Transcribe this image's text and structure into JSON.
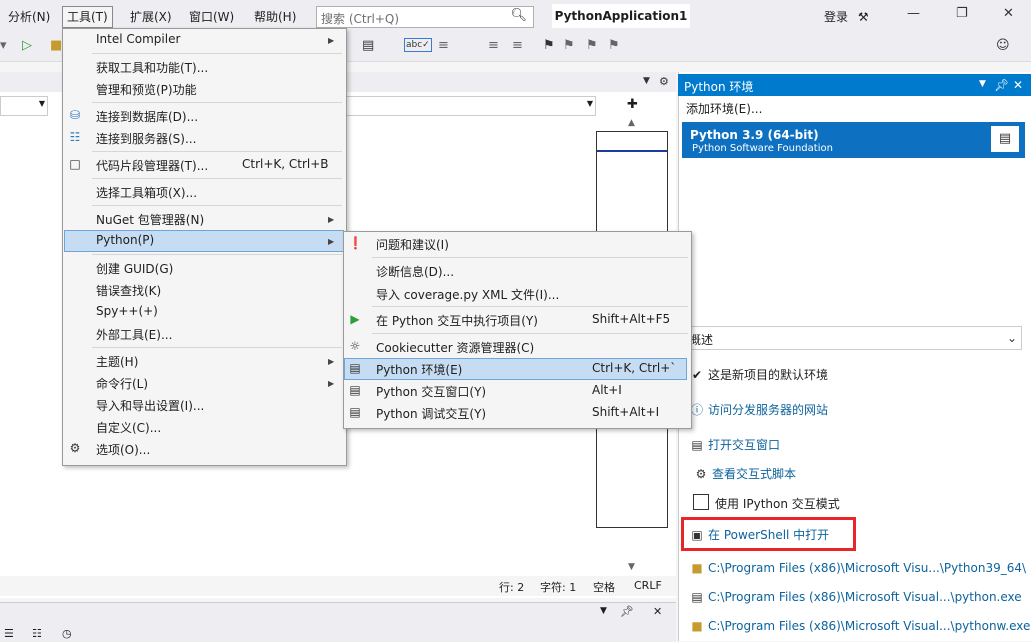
{
  "menubar": {
    "items": [
      "分析(N)",
      "工具(T)",
      "扩展(X)",
      "窗口(W)",
      "帮助(H)"
    ],
    "search_placeholder": "搜索 (Ctrl+Q)",
    "project_title": "PythonApplication1",
    "login": "登录"
  },
  "tools_menu": {
    "intel": "Intel Compiler",
    "get_tools": "获取工具和功能(T)...",
    "manage_preview": "管理和预览(P)功能",
    "connect_db": "连接到数据库(D)...",
    "connect_server": "连接到服务器(S)...",
    "snippets": "代码片段管理器(T)...",
    "snippets_sc": "Ctrl+K, Ctrl+B",
    "toolbox": "选择工具箱项(X)...",
    "nuget": "NuGet 包管理器(N)",
    "python": "Python(P)",
    "guid": "创建 GUID(G)",
    "errlookup": "错误查找(K)",
    "spy": "Spy++(+)",
    "external": "外部工具(E)...",
    "theme": "主题(H)",
    "cmdline": "命令行(L)",
    "import_export": "导入和导出设置(I)...",
    "customize": "自定义(C)...",
    "options": "选项(O)..."
  },
  "python_submenu": {
    "issues": "问题和建议(I)",
    "diag": "诊断信息(D)...",
    "coverage": "导入 coverage.py XML 文件(I)...",
    "exec_interactive": "在 Python 交互中执行项目(Y)",
    "exec_interactive_sc": "Shift+Alt+F5",
    "cookiecutter": "Cookiecutter 资源管理器(C)",
    "env": "Python 环境(E)",
    "env_sc": "Ctrl+K, Ctrl+`",
    "interactive": "Python 交互窗口(Y)",
    "interactive_sc": "Alt+I",
    "debug_interactive": "Python 调试交互(Y)",
    "debug_interactive_sc": "Shift+Alt+I"
  },
  "env_panel": {
    "title": "Python 环境",
    "add_env": "添加环境(E)...",
    "selected_name": "Python 3.9 (64-bit)",
    "selected_publisher": "Python Software Foundation",
    "view_select": "概述",
    "default_env": "这是新项目的默认环境",
    "visit_site": "访问分发服务器的网站",
    "open_interactive": "打开交互窗口",
    "view_scripts": "查看交互式脚本",
    "use_ipython": "使用 IPython 交互模式",
    "open_powershell": "在 PowerShell 中打开",
    "path1": "C:\\Program Files (x86)\\Microsoft Visu...\\Python39_64\\",
    "path2": "C:\\Program Files (x86)\\Microsoft Visual...\\python.exe",
    "path3": "C:\\Program Files (x86)\\Microsoft Visual...\\pythonw.exe"
  },
  "status": {
    "line": "行: 2",
    "char": "字符: 1",
    "space": "空格",
    "eol": "CRLF"
  }
}
